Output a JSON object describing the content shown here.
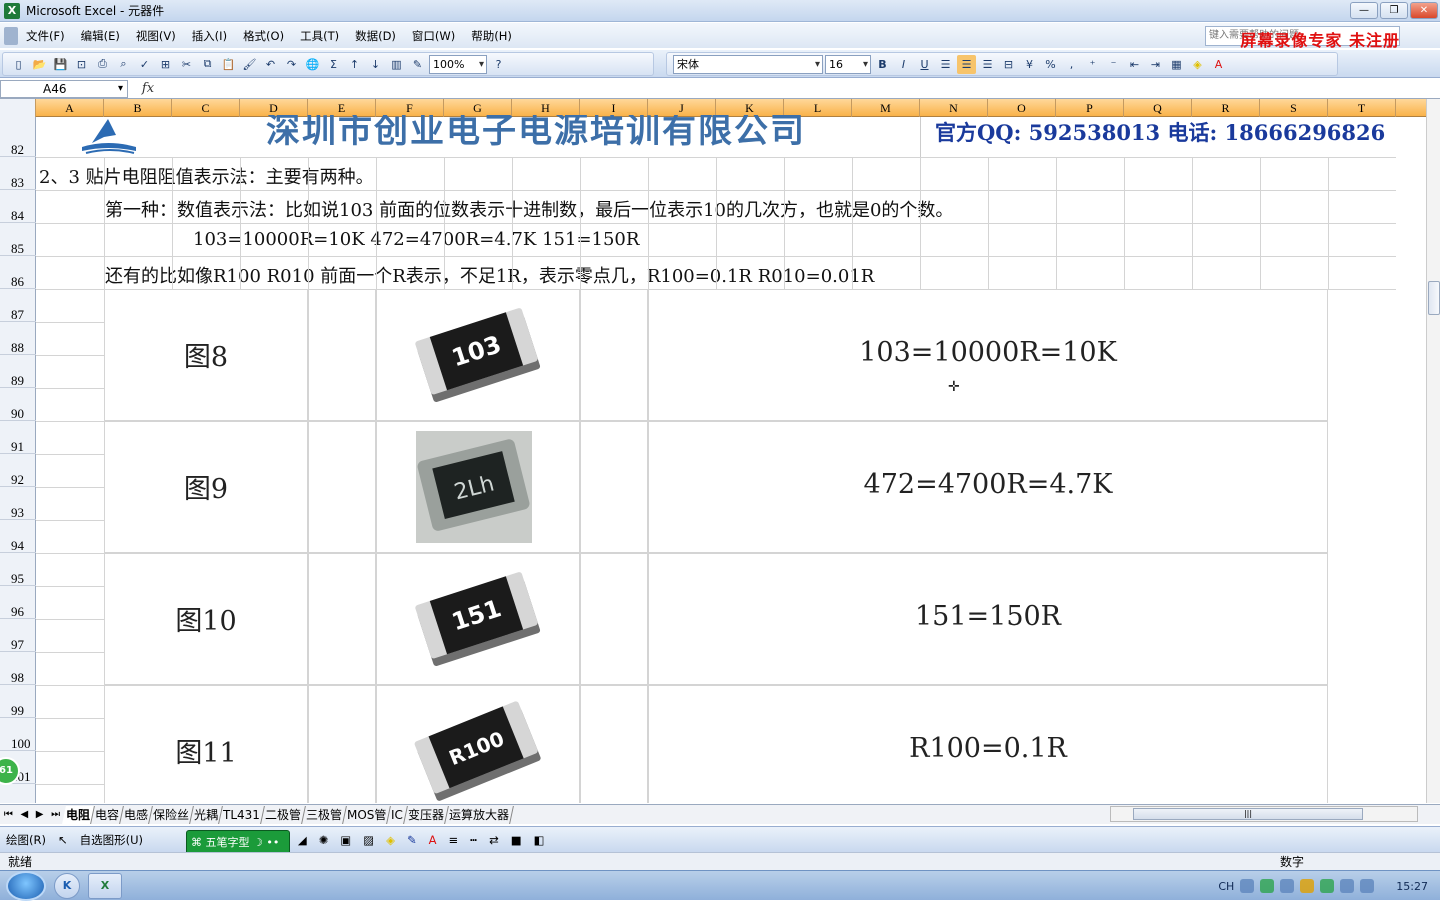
{
  "window": {
    "title": "Microsoft Excel - 元器件",
    "app_icon": "excel-icon"
  },
  "menu": [
    "文件(F)",
    "编辑(E)",
    "视图(V)",
    "插入(I)",
    "格式(O)",
    "工具(T)",
    "数据(D)",
    "窗口(W)",
    "帮助(H)"
  ],
  "help_box": "键入需要帮助的问题",
  "watermark": "屏幕录像专家  未注册",
  "toolbar": {
    "zoom": "100%",
    "font": "宋体",
    "font_size": "16",
    "bold": "B",
    "italic": "I",
    "underline": "U",
    "percent": "%",
    "comma": ","
  },
  "formula": {
    "name_box": "A46",
    "fx": "fx",
    "content": ""
  },
  "columns": [
    "A",
    "B",
    "C",
    "D",
    "E",
    "F",
    "G",
    "H",
    "I",
    "J",
    "K",
    "L",
    "M",
    "N",
    "O",
    "P",
    "Q",
    "R",
    "S",
    "T"
  ],
  "rows": [
    "82",
    "83",
    "84",
    "85",
    "86",
    "87",
    "88",
    "89",
    "90",
    "91",
    "92",
    "93",
    "94",
    "95",
    "96",
    "97",
    "98",
    "99",
    "100",
    "101"
  ],
  "header": {
    "company": "深圳市创业电子电源培训有限公司",
    "contact": "官方QQ: 592538013  电话: 18666296826"
  },
  "content": {
    "line83": "2、3  贴片电阻阻值表示法：主要有两种。",
    "line84": "第一种：数值表示法：比如说103 前面的位数表示十进制数，最后一位表示10的几次方，也就是0的个数。",
    "line85": "103=10000R=10K   472=4700R=4.7K   151=150R",
    "line86": "还有的比如像R100 R010 前面一个R表示，不足1R，表示零点几，R100=0.1R  R010=0.01R"
  },
  "figures": [
    {
      "label": "图8",
      "marking": "103",
      "value": "103=10000R=10K"
    },
    {
      "label": "图9",
      "marking": "2Lh",
      "value": "472=4700R=4.7K"
    },
    {
      "label": "图10",
      "marking": "151",
      "value": "151=150R"
    },
    {
      "label": "图11",
      "marking": "R100",
      "value": "R100=0.1R"
    }
  ],
  "sheets": [
    "电阻",
    "电容",
    "电感",
    "保险丝",
    "光耦",
    "TL431",
    "二极管",
    "三极管",
    "MOS管",
    "IC",
    "变压器",
    "运算放大器"
  ],
  "active_sheet": 0,
  "drawbar": {
    "draw": "绘图(R)",
    "autoshape": "自选图形(U)"
  },
  "ime": {
    "mode": "五笔字型",
    "simp": "简"
  },
  "status": {
    "ready": "就绪",
    "num": "数字"
  },
  "green_badge": "61",
  "taskbar": {
    "lang": "CH",
    "time": "15:27"
  },
  "colors": {
    "accent": "#f9b24a",
    "watermark": "#e01010",
    "contact": "#1a3a9c",
    "company": "#3d6fa8"
  }
}
